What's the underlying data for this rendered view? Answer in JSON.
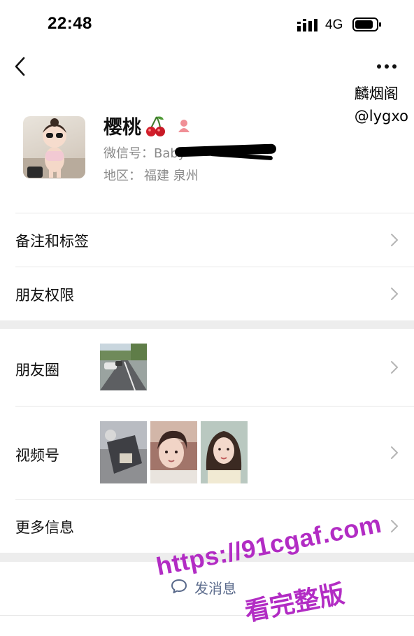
{
  "status_bar": {
    "time": "22:48",
    "network": "4G",
    "signal_icon": "signal-bars-icon",
    "battery_icon": "battery-icon"
  },
  "nav": {
    "back_icon": "chevron-left-icon",
    "more_icon": "ellipsis-icon"
  },
  "watermark_top": {
    "line1": "麟烟阁",
    "line2": "@lygxo"
  },
  "profile": {
    "nickname": "樱桃",
    "cherry_icon": "cherry-icon",
    "gender_icon": "female-icon",
    "wechat_id_label": "微信号：Baby",
    "region_label": "地区：",
    "region_value": "福建 泉州"
  },
  "rows": {
    "remarks_tags": "备注和标签",
    "friend_permissions": "朋友权限",
    "moments": "朋友圈",
    "channels": "视频号",
    "more_info": "更多信息"
  },
  "actions": {
    "send_message": "发消息",
    "chat_icon": "chat-bubble-icon"
  },
  "watermark_bottom": {
    "url": "https://91cgaf.com",
    "text": "看完整版"
  },
  "colors": {
    "link_blue": "#5b6b8c",
    "gap_gray": "#ededed",
    "divider": "#e7e7e7",
    "watermark_purple": "#b22cc4",
    "secondary_text": "#8a8a8a"
  }
}
